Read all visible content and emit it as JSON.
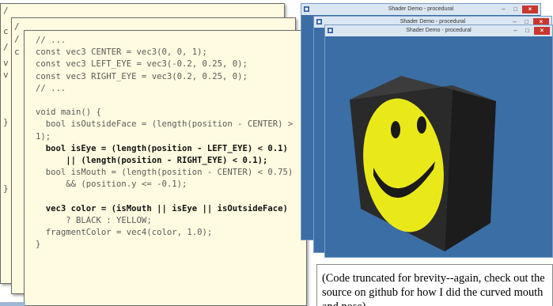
{
  "code_card_back": {
    "peek_chars": [
      "/",
      "c",
      "/",
      "v",
      "v",
      "}",
      "}"
    ]
  },
  "code_card_middle": {
    "peek_chars": [
      "/",
      "/",
      "c"
    ]
  },
  "code": {
    "lines": [
      "// ...",
      "const vec3 CENTER = vec3(0, 0, 1);",
      "const vec3 LEFT_EYE = vec3(-0.2, 0.25, 0);",
      "const vec3 RIGHT_EYE = vec3(0.2, 0.25, 0);",
      "// ...",
      "",
      "void main() {",
      "  bool isOutsideFace = (length(position - CENTER) >",
      "1);",
      "  bool isEye = (length(position - LEFT_EYE) < 0.1)",
      "      || (length(position - RIGHT_EYE) < 0.1);",
      "  bool isMouth = (length(position - CENTER) < 0.75)",
      "      && (position.y <= -0.1);",
      "",
      "  vec3 color = (isMouth || isEye || isOutsideFace)",
      "      ? BLACK : YELLOW;",
      "  fragmentColor = vec4(color, 1.0);",
      "}"
    ]
  },
  "windows": [
    {
      "title": "Shader Demo - procedural"
    },
    {
      "title": "Shader Demo - procedural"
    },
    {
      "title": "Shader Demo - procedural"
    }
  ],
  "window_controls": {
    "minimize": "–",
    "maximize": "□",
    "close": "×"
  },
  "caption": {
    "text": "(Code truncated for brevity--again, check out the source on github for how I did the curved mouth and nose)"
  },
  "colors": {
    "canvas_bg": "#3a6ea5",
    "cube_top": "#3c3c3c",
    "cube_left": "#2a2a2a",
    "cube_right": "#1c1c1c",
    "face_yellow": "#e9e91a",
    "close_button": "#c8372d"
  }
}
